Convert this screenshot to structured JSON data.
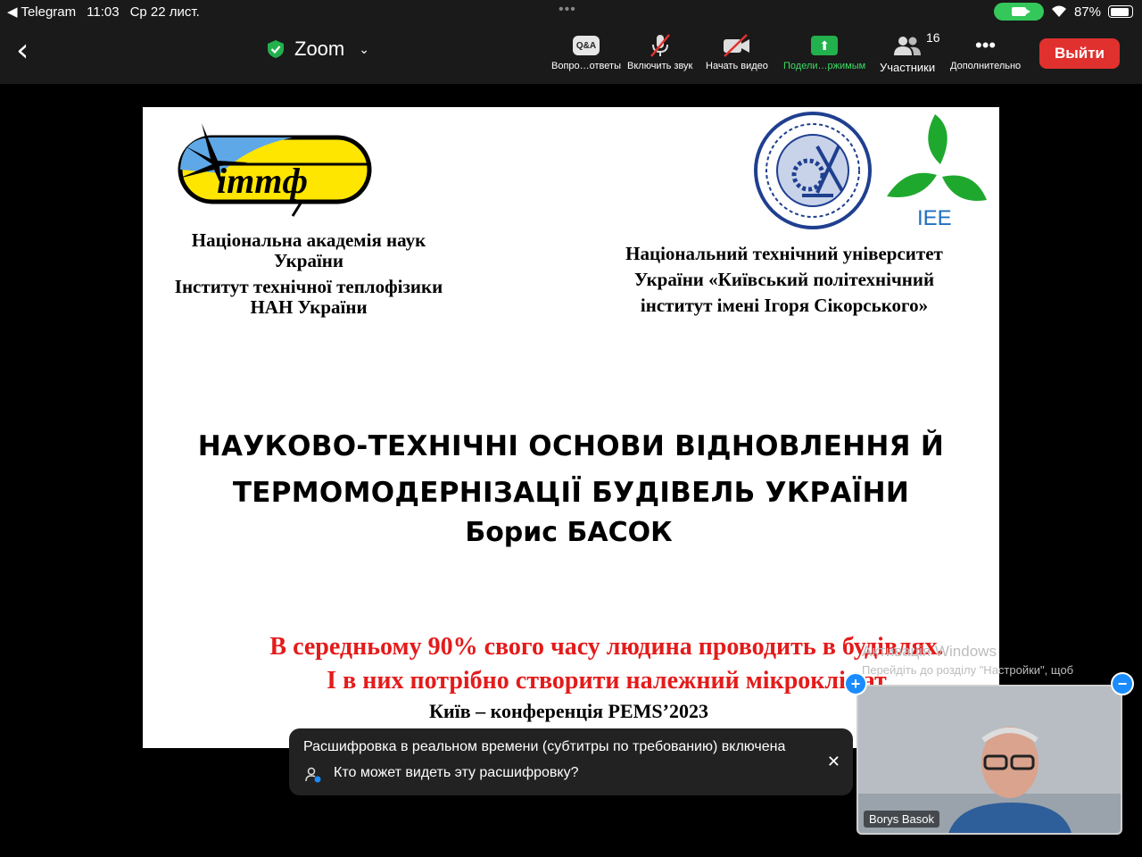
{
  "status_bar": {
    "back_app": "Telegram",
    "time": "11:03",
    "date": "Ср 22 лист.",
    "battery": "87%"
  },
  "toolbar": {
    "app_title": "Zoom",
    "qa_icon_text": "Q&A",
    "qa_label": "Вопро…ответы",
    "audio_label": "Включить звук",
    "video_label": "Начать видео",
    "share_label": "Подели…ржимым",
    "participants_label": "Участники",
    "participants_count": "16",
    "more_label": "Дополнительно",
    "leave_label": "Выйти"
  },
  "slide": {
    "logo_left_text": "іттф",
    "logo_right_text": "IEE",
    "left_org": [
      "Національна академія наук",
      "України",
      "Інститут технічної теплофізики",
      "НАН України"
    ],
    "right_org": [
      "Національний технічний університет",
      "України «Київський політехнічний",
      "інститут імені Ігоря Сікорського»"
    ],
    "title": [
      "НАУКОВО-ТЕХНІЧНІ ОСНОВИ ВІДНОВЛЕННЯ Й",
      "ТЕРМОМОДЕРНІЗАЦІЇ  БУДІВЕЛЬ  УКРАЇНИ"
    ],
    "author": "Борис БАСОК",
    "quote": [
      "В середньому 90% свого часу людина проводить в будівлях.",
      "І в них потрібно створити належний мікроклімат"
    ],
    "city": "Київ – конференція  PEMS’2023",
    "watermark_1": "Активація Windows",
    "watermark_2": "Перейдіть до розділу \"Настройки\", щоб"
  },
  "banner": {
    "line1": "Расшифровка в реальном времени (субтитры по требованию) включена",
    "line2": "Кто может видеть эту расшифровку?"
  },
  "thumbnail": {
    "name": "Borys Basok"
  },
  "colors": {
    "leave": "#e0312e",
    "share": "#22b14c",
    "quote": "#e41b1b",
    "bar_bg": "#1a1a1a"
  }
}
